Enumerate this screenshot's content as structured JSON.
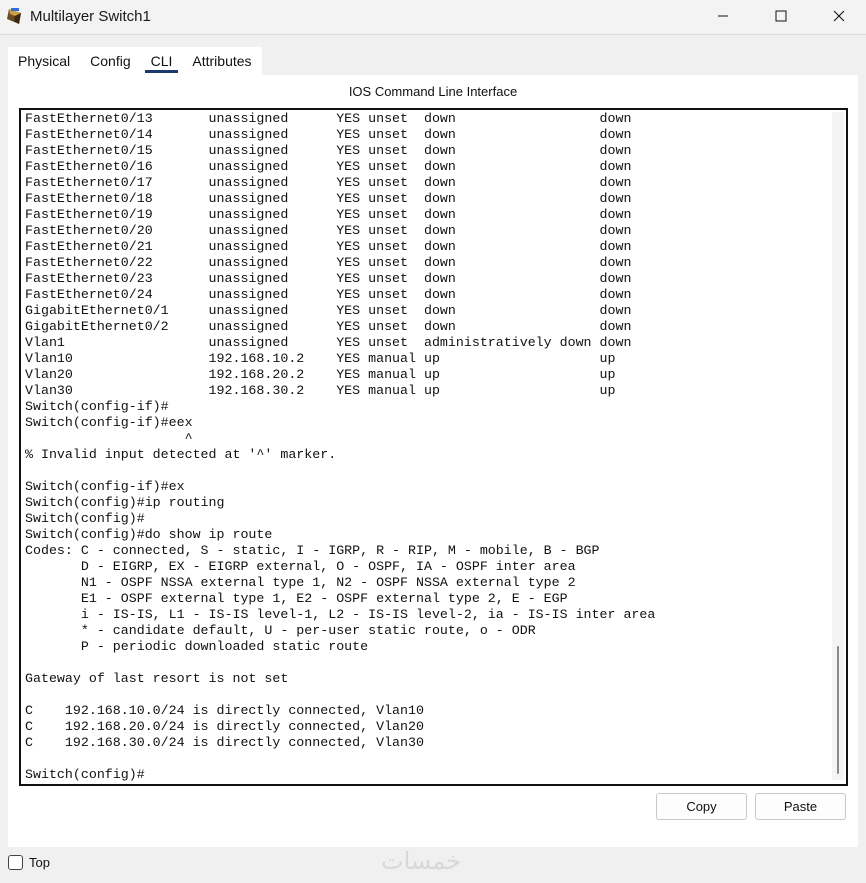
{
  "window": {
    "title": "Multilayer Switch1",
    "controls": {
      "minimize": "minimize-icon",
      "maximize": "maximize-icon",
      "close": "close-icon"
    }
  },
  "tabs": [
    {
      "label": "Physical",
      "active": false
    },
    {
      "label": "Config",
      "active": false
    },
    {
      "label": "CLI",
      "active": true
    },
    {
      "label": "Attributes",
      "active": false
    }
  ],
  "panel": {
    "header": "IOS Command Line Interface"
  },
  "terminal": {
    "lines": [
      "FastEthernet0/13       unassigned      YES unset  down                  down",
      "FastEthernet0/14       unassigned      YES unset  down                  down",
      "FastEthernet0/15       unassigned      YES unset  down                  down",
      "FastEthernet0/16       unassigned      YES unset  down                  down",
      "FastEthernet0/17       unassigned      YES unset  down                  down",
      "FastEthernet0/18       unassigned      YES unset  down                  down",
      "FastEthernet0/19       unassigned      YES unset  down                  down",
      "FastEthernet0/20       unassigned      YES unset  down                  down",
      "FastEthernet0/21       unassigned      YES unset  down                  down",
      "FastEthernet0/22       unassigned      YES unset  down                  down",
      "FastEthernet0/23       unassigned      YES unset  down                  down",
      "FastEthernet0/24       unassigned      YES unset  down                  down",
      "GigabitEthernet0/1     unassigned      YES unset  down                  down",
      "GigabitEthernet0/2     unassigned      YES unset  down                  down",
      "Vlan1                  unassigned      YES unset  administratively down down",
      "Vlan10                 192.168.10.2    YES manual up                    up",
      "Vlan20                 192.168.20.2    YES manual up                    up",
      "Vlan30                 192.168.30.2    YES manual up                    up",
      "Switch(config-if)#",
      "Switch(config-if)#eex",
      "                    ^",
      "% Invalid input detected at '^' marker.",
      "",
      "Switch(config-if)#ex",
      "Switch(config)#ip routing",
      "Switch(config)#",
      "Switch(config)#do show ip route",
      "Codes: C - connected, S - static, I - IGRP, R - RIP, M - mobile, B - BGP",
      "       D - EIGRP, EX - EIGRP external, O - OSPF, IA - OSPF inter area",
      "       N1 - OSPF NSSA external type 1, N2 - OSPF NSSA external type 2",
      "       E1 - OSPF external type 1, E2 - OSPF external type 2, E - EGP",
      "       i - IS-IS, L1 - IS-IS level-1, L2 - IS-IS level-2, ia - IS-IS inter area",
      "       * - candidate default, U - per-user static route, o - ODR",
      "       P - periodic downloaded static route",
      "",
      "Gateway of last resort is not set",
      "",
      "C    192.168.10.0/24 is directly connected, Vlan10",
      "C    192.168.20.0/24 is directly connected, Vlan20",
      "C    192.168.30.0/24 is directly connected, Vlan30",
      "",
      "Switch(config)#"
    ],
    "scroll_position": 1.0
  },
  "buttons": {
    "copy": "Copy",
    "paste": "Paste"
  },
  "bottom": {
    "top_label": "Top",
    "top_checked": false,
    "watermark": "خمسات"
  }
}
